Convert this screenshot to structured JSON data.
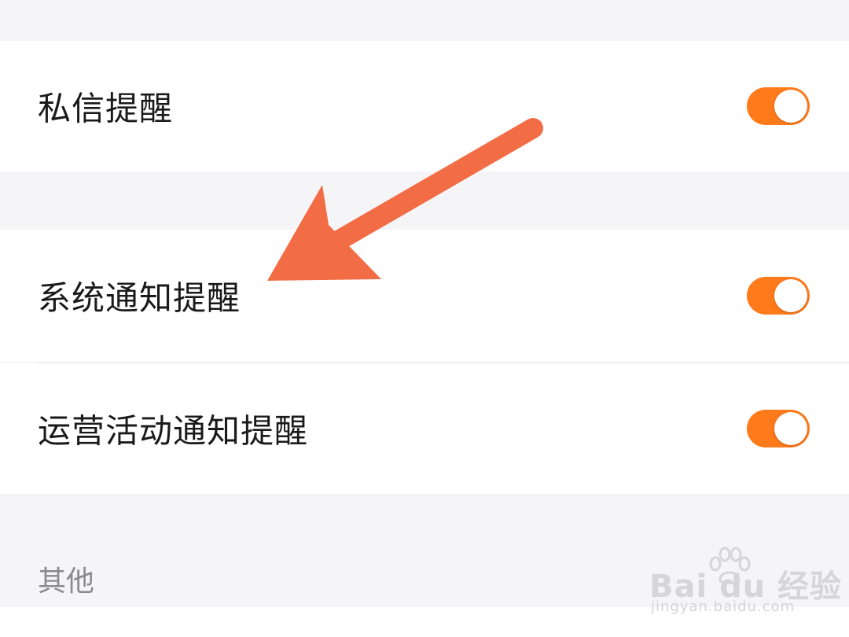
{
  "settings": {
    "rows": [
      {
        "label": "私信提醒",
        "enabled": true
      },
      {
        "label": "系统通知提醒",
        "enabled": true
      },
      {
        "label": "运营活动通知提醒",
        "enabled": true
      }
    ],
    "section_other": "其他"
  },
  "colors": {
    "accent": "#ff7a1a",
    "arrow": "#f26d45",
    "background": "#f5f5f7",
    "row_bg": "#ffffff",
    "text": "#1a1a1a",
    "section_text": "#8a8a8f"
  },
  "watermark": {
    "brand": "Bai du 经验",
    "url": "jingyan.baidu.com"
  }
}
